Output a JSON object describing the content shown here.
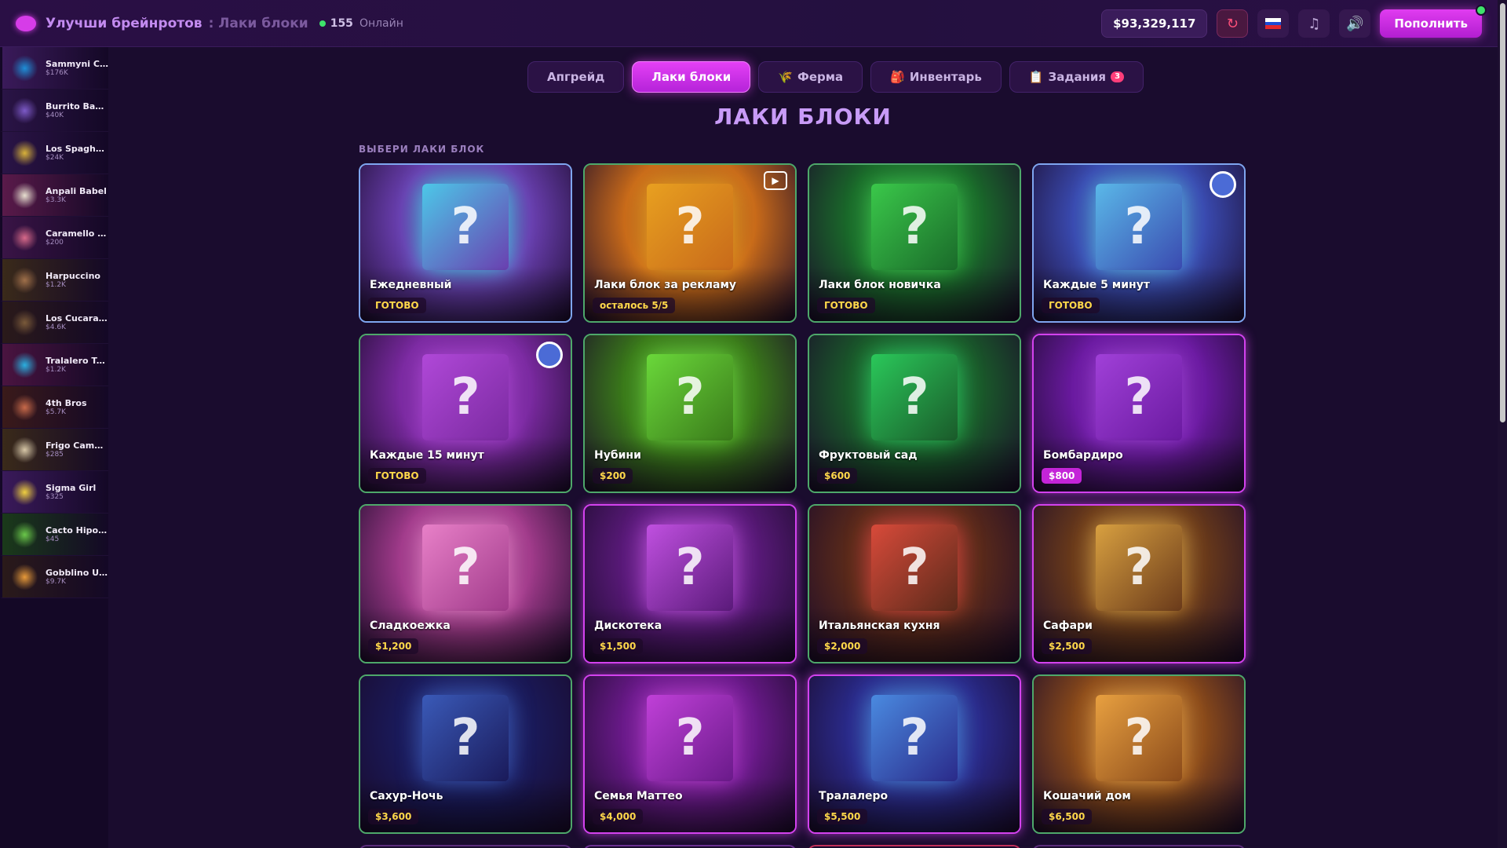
{
  "header": {
    "title": "Улучши брейнротов",
    "subtitle": ": Лаки блоки",
    "online_count": "155",
    "online_label": "Онлайн",
    "balance": "$93,329,117",
    "deposit_label": "Пополнить",
    "icons": [
      "refresh-icon",
      "ru-flag-icon",
      "music-icon",
      "sound-icon"
    ]
  },
  "sidebar": {
    "items": [
      {
        "name": "Sammyni Cak...",
        "price": "$176K",
        "color": "#1e8fd8",
        "accent": "#3a1a5a"
      },
      {
        "name": "Burrito Bandi...",
        "price": "$40K",
        "color": "#7d5ac8",
        "accent": "#2a1446"
      },
      {
        "name": "Los Spaghettis",
        "price": "$24K",
        "color": "#d8b23a",
        "accent": "#2a1446"
      },
      {
        "name": "Anpali Babel",
        "price": "$3.3K",
        "color": "#e8e0d0",
        "accent": "#5a1a4a"
      },
      {
        "name": "Caramello Fil...",
        "price": "$200",
        "color": "#d86a8a",
        "accent": "#3a1446"
      },
      {
        "name": "Harpuccino",
        "price": "$1.2K",
        "color": "#a0704a",
        "accent": "#3a2a1a"
      },
      {
        "name": "Los Cucarachas",
        "price": "$4.6K",
        "color": "#7a5a3a",
        "accent": "#2a1a1a"
      },
      {
        "name": "Tralalero Tra...",
        "price": "$1.2K",
        "color": "#2ab0e0",
        "accent": "#4a1440"
      },
      {
        "name": "4th Bros",
        "price": "$5.7K",
        "color": "#c86a4a",
        "accent": "#3a1a1a"
      },
      {
        "name": "Frigo Camelo",
        "price": "$285",
        "color": "#d8c8a8",
        "accent": "#3a2a1a"
      },
      {
        "name": "Sigma Girl",
        "price": "$325",
        "color": "#f0d040",
        "accent": "#3a1a5a"
      },
      {
        "name": "Cacto Hipop...",
        "price": "$45",
        "color": "#6ac84a",
        "accent": "#1a3a1a"
      },
      {
        "name": "Gobblino Uni...",
        "price": "$9.7K",
        "color": "#e89a3a",
        "accent": "#2a1a1a"
      }
    ]
  },
  "tabs": [
    {
      "label": "Апгрейд",
      "icon": "",
      "active": false
    },
    {
      "label": "Лаки блоки",
      "icon": "",
      "active": true
    },
    {
      "label": "Ферма",
      "icon": "🌾",
      "active": false
    },
    {
      "label": "Инвентарь",
      "icon": "🎒",
      "active": false
    },
    {
      "label": "Задания",
      "icon": "📋",
      "active": false,
      "badge": "3"
    }
  ],
  "page_title": "ЛАКИ БЛОКИ",
  "section_label": "ВЫБЕРИ ЛАКИ БЛОК",
  "blocks": [
    {
      "name": "Ежедневный",
      "status": "ГОТОВО",
      "bg": "#6a3fb0",
      "cube": "#4cc8e8",
      "border": "blue-border",
      "corner": ""
    },
    {
      "name": "Лаки блок за рекламу",
      "status": "осталось 5/5",
      "bg": "#c86a1a",
      "cube": "#e8a020",
      "border": "green-border",
      "corner": "video"
    },
    {
      "name": "Лаки блок новичка",
      "status": "ГОТОВО",
      "bg": "#1a6a2a",
      "cube": "#3ac84a",
      "border": "green-border",
      "corner": ""
    },
    {
      "name": "Каждые 5 минут",
      "status": "ГОТОВО",
      "bg": "#3a4ab0",
      "cube": "#5ab8e8",
      "border": "blue-border",
      "corner": "clock"
    },
    {
      "name": "Каждые 15 минут",
      "status": "ГОТОВО",
      "bg": "#7a2aa0",
      "cube": "#b048d8",
      "border": "green-border",
      "corner": "clock"
    },
    {
      "name": "Нубини",
      "status": "$200",
      "bg": "#3a7a1a",
      "cube": "#6ad83a",
      "border": "green-border",
      "corner": ""
    },
    {
      "name": "Фруктовый сад",
      "status": "$600",
      "bg": "#1a5a2a",
      "cube": "#2ac85a",
      "border": "green-border",
      "corner": ""
    },
    {
      "name": "Бомбардиро",
      "status": "$800",
      "status_style": "pink",
      "bg": "#6a1aa0",
      "cube": "#a040d8",
      "border": "pink-border",
      "corner": ""
    },
    {
      "name": "Сладкоежка",
      "status": "$1,200",
      "bg": "#a03a8a",
      "cube": "#e880c8",
      "border": "green-border",
      "corner": ""
    },
    {
      "name": "Дискотека",
      "status": "$1,500",
      "bg": "#5a1a7a",
      "cube": "#c050e0",
      "border": "pink-border",
      "corner": ""
    },
    {
      "name": "Итальянская кухня",
      "status": "$2,000",
      "bg": "#5a2a1a",
      "cube": "#d84a3a",
      "border": "green-border",
      "corner": ""
    },
    {
      "name": "Сафари",
      "status": "$2,500",
      "bg": "#6a3a1a",
      "cube": "#d8a040",
      "border": "pink-border",
      "corner": ""
    },
    {
      "name": "Сахур-Ночь",
      "status": "$3,600",
      "bg": "#1a1a5a",
      "cube": "#3a5ab8",
      "border": "green-border",
      "corner": ""
    },
    {
      "name": "Семья Маттео",
      "status": "$4,000",
      "bg": "#6a1a8a",
      "cube": "#c040d8",
      "border": "pink-border",
      "corner": ""
    },
    {
      "name": "Тралалеро",
      "status": "$5,500",
      "bg": "#2a2a8a",
      "cube": "#4a8ae0",
      "border": "pink-border",
      "corner": ""
    },
    {
      "name": "Кошачий дом",
      "status": "$6,500",
      "bg": "#8a4a1a",
      "cube": "#e8a040",
      "border": "green-border",
      "corner": ""
    }
  ]
}
